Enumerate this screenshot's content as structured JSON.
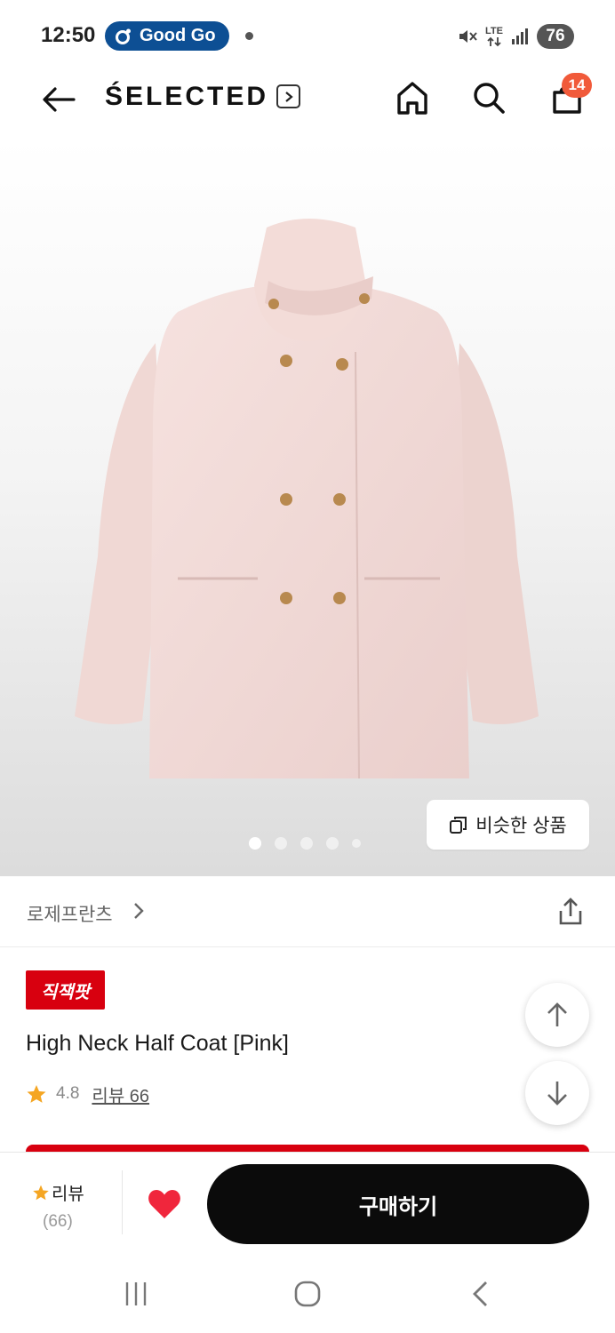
{
  "status_bar": {
    "time": "12:50",
    "notification_pill": "Good Go",
    "network": "LTE",
    "battery": "76",
    "icons": [
      "mute-icon",
      "lte-icon",
      "signal-icon"
    ]
  },
  "header": {
    "brand": "ŚELECTED",
    "cart_count": "14",
    "icons": [
      "back-arrow-icon",
      "chevron-right-icon",
      "home-icon",
      "search-icon",
      "shopping-bag-icon"
    ]
  },
  "product_image": {
    "description_icon": "pink-coat-illustration",
    "similar_button_label": "비슷한 상품",
    "carousel": {
      "total": 5,
      "active_index": 0
    }
  },
  "brand_row": {
    "brand_name": "로제프란츠",
    "icons": [
      "chevron-right-icon",
      "share-icon"
    ]
  },
  "product": {
    "promo_badge": "직잭팟",
    "title": "High Neck Half Coat [Pink]",
    "rating": "4.8",
    "review_link": "리뷰 66"
  },
  "action_bar": {
    "review_label": "리뷰",
    "review_count": "(66)",
    "buy_label": "구매하기",
    "accent_red": "#d8000f",
    "star_color": "#f5a623",
    "heart_color": "#f0263c"
  }
}
